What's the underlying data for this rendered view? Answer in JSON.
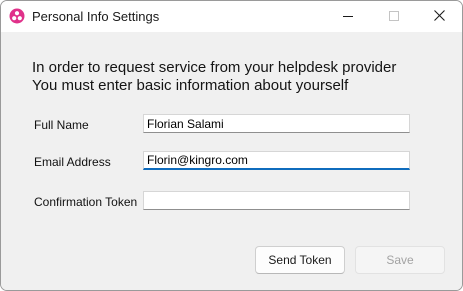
{
  "window": {
    "title": "Personal Info Settings"
  },
  "intro": {
    "line1": "In order to request service from your helpdesk provider",
    "line2": "You must enter basic information about yourself"
  },
  "form": {
    "full_name": {
      "label": "Full Name",
      "value": "Florian Salami"
    },
    "email": {
      "label": "Email Address",
      "value": "Florin@kingro.com"
    },
    "token": {
      "label": "Confirmation Token",
      "value": ""
    }
  },
  "buttons": {
    "send_label": "Send Token",
    "save_label": "Save"
  },
  "colors": {
    "accent": "#0f6cbd",
    "app_icon": "#e0318a",
    "background": "#f0f0f0"
  },
  "icons": {
    "app": "app-logo-icon",
    "minimize": "minimize-icon",
    "maximize": "maximize-icon",
    "close": "close-icon"
  }
}
